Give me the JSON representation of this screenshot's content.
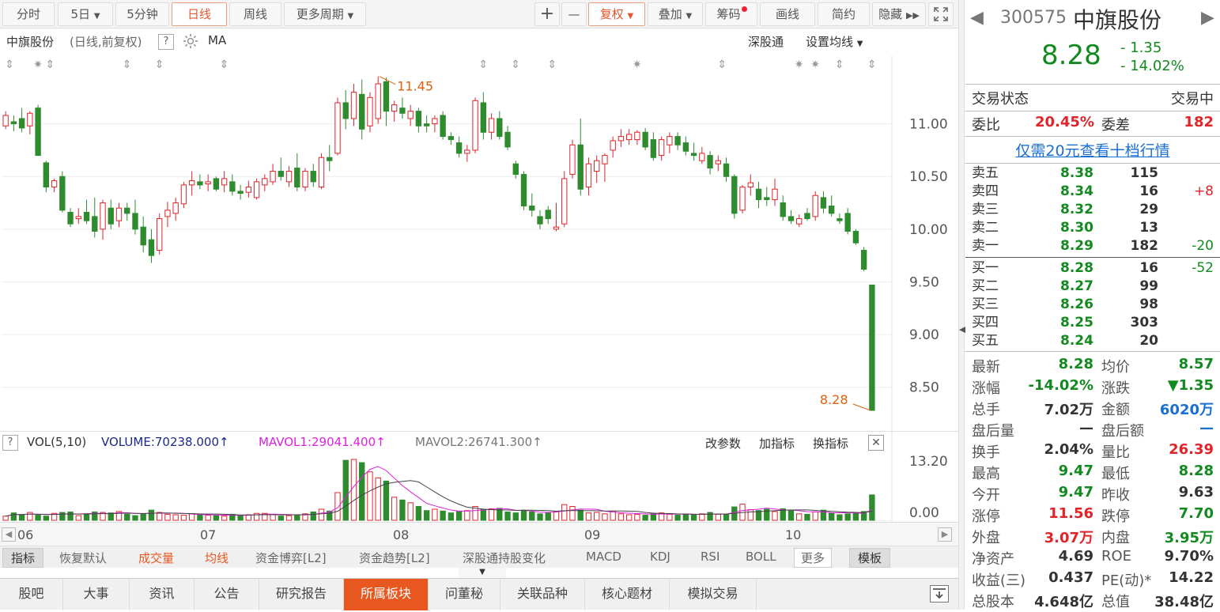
{
  "toolbar": {
    "buttons": [
      "分时",
      "5日",
      "5分钟",
      "日线",
      "周线",
      "更多周期"
    ],
    "active": "日线",
    "plus": "+",
    "minus": "—",
    "fuquan": "复权",
    "diejia": "叠加",
    "chouma": "筹码",
    "huaxian": "画线",
    "jianyue": "简约",
    "yincang": "隐藏"
  },
  "chart_header": {
    "name": "中旗股份",
    "mode": "(日线,前复权)",
    "help": "?",
    "ma": "MA",
    "sgt": "深股通",
    "set_ma": "设置均线"
  },
  "chart_data": [
    {
      "type": "candlestick",
      "x_labels": [
        "06",
        "07",
        "08",
        "09",
        "10"
      ],
      "y_ticks": [
        "11.00",
        "10.50",
        "10.00",
        "9.50",
        "9.00",
        "8.50"
      ],
      "ylim": [
        8.1,
        11.65
      ],
      "annotations": {
        "high": "11.45",
        "last": "8.28"
      },
      "ohlc": [
        [
          10.98,
          11.12,
          10.95,
          11.08
        ],
        [
          11.02,
          11.08,
          10.93,
          11.0
        ],
        [
          11.05,
          11.15,
          10.92,
          10.96
        ],
        [
          10.98,
          11.12,
          10.9,
          11.1
        ],
        [
          11.15,
          11.18,
          10.7,
          10.7
        ],
        [
          10.63,
          10.65,
          10.35,
          10.4
        ],
        [
          10.4,
          10.48,
          10.35,
          10.46
        ],
        [
          10.5,
          10.55,
          10.16,
          10.18
        ],
        [
          10.16,
          10.2,
          10.02,
          10.05
        ],
        [
          10.1,
          10.2,
          10.05,
          10.12
        ],
        [
          10.16,
          10.28,
          10.05,
          10.08
        ],
        [
          10.12,
          10.3,
          9.92,
          9.98
        ],
        [
          10.0,
          10.28,
          9.9,
          10.25
        ],
        [
          10.2,
          10.28,
          10.0,
          10.05
        ],
        [
          10.08,
          10.25,
          10.02,
          10.2
        ],
        [
          10.2,
          10.25,
          10.08,
          10.15
        ],
        [
          10.15,
          10.28,
          9.95,
          10.0
        ],
        [
          10.02,
          10.12,
          9.78,
          9.85
        ],
        [
          9.9,
          10.0,
          9.68,
          9.75
        ],
        [
          9.8,
          10.15,
          9.76,
          10.1
        ],
        [
          10.12,
          10.26,
          10.02,
          10.18
        ],
        [
          10.15,
          10.3,
          10.08,
          10.25
        ],
        [
          10.24,
          10.45,
          10.2,
          10.42
        ],
        [
          10.42,
          10.55,
          10.32,
          10.46
        ],
        [
          10.45,
          10.52,
          10.38,
          10.42
        ],
        [
          10.43,
          10.52,
          10.36,
          10.45
        ],
        [
          10.48,
          10.5,
          10.36,
          10.38
        ],
        [
          10.42,
          10.55,
          10.35,
          10.48
        ],
        [
          10.45,
          10.52,
          10.32,
          10.36
        ],
        [
          10.36,
          10.42,
          10.28,
          10.34
        ],
        [
          10.35,
          10.46,
          10.3,
          10.4
        ],
        [
          10.3,
          10.48,
          10.28,
          10.45
        ],
        [
          10.42,
          10.52,
          10.36,
          10.48
        ],
        [
          10.45,
          10.62,
          10.42,
          10.55
        ],
        [
          10.55,
          10.68,
          10.46,
          10.5
        ],
        [
          10.45,
          10.6,
          10.4,
          10.55
        ],
        [
          10.58,
          10.72,
          10.36,
          10.4
        ],
        [
          10.4,
          10.58,
          10.36,
          10.55
        ],
        [
          10.55,
          10.62,
          10.4,
          10.45
        ],
        [
          10.4,
          10.72,
          10.38,
          10.68
        ],
        [
          10.68,
          10.8,
          10.55,
          10.65
        ],
        [
          10.72,
          11.25,
          10.7,
          11.2
        ],
        [
          11.2,
          11.32,
          10.95,
          11.05
        ],
        [
          11.05,
          11.38,
          10.98,
          11.3
        ],
        [
          11.28,
          11.42,
          10.85,
          10.95
        ],
        [
          10.98,
          11.3,
          10.92,
          11.25
        ],
        [
          11.05,
          11.45,
          11.0,
          11.38
        ],
        [
          11.4,
          11.44,
          10.98,
          11.12
        ],
        [
          11.12,
          11.22,
          11.02,
          11.18
        ],
        [
          11.15,
          11.25,
          11.05,
          11.1
        ],
        [
          11.05,
          11.18,
          10.98,
          11.12
        ],
        [
          11.12,
          11.15,
          10.92,
          10.98
        ],
        [
          11.0,
          11.08,
          10.92,
          10.98
        ],
        [
          11.0,
          11.08,
          10.92,
          11.05
        ],
        [
          11.08,
          11.12,
          10.85,
          10.88
        ],
        [
          10.88,
          10.92,
          10.8,
          10.85
        ],
        [
          10.82,
          10.88,
          10.68,
          10.72
        ],
        [
          10.72,
          10.8,
          10.64,
          10.75
        ],
        [
          10.75,
          11.25,
          10.72,
          11.22
        ],
        [
          11.2,
          11.3,
          10.85,
          10.92
        ],
        [
          10.92,
          11.1,
          10.85,
          11.05
        ],
        [
          11.05,
          11.12,
          10.85,
          10.88
        ],
        [
          10.92,
          10.98,
          10.75,
          10.78
        ],
        [
          10.62,
          10.65,
          10.48,
          10.52
        ],
        [
          10.52,
          10.55,
          10.18,
          10.22
        ],
        [
          10.22,
          10.34,
          10.12,
          10.18
        ],
        [
          10.12,
          10.18,
          10.0,
          10.05
        ],
        [
          10.18,
          10.22,
          10.05,
          10.1
        ],
        [
          10.0,
          10.25,
          9.98,
          10.02
        ],
        [
          10.05,
          10.55,
          10.02,
          10.48
        ],
        [
          10.52,
          10.85,
          10.48,
          10.8
        ],
        [
          10.8,
          11.05,
          10.32,
          10.38
        ],
        [
          10.4,
          10.68,
          10.32,
          10.62
        ],
        [
          10.55,
          10.7,
          10.44,
          10.65
        ],
        [
          10.62,
          10.72,
          10.45,
          10.7
        ],
        [
          10.75,
          10.88,
          10.68,
          10.84
        ],
        [
          10.84,
          10.95,
          10.78,
          10.88
        ],
        [
          10.85,
          10.95,
          10.8,
          10.9
        ],
        [
          10.85,
          10.94,
          10.8,
          10.92
        ],
        [
          10.92,
          10.96,
          10.75,
          10.78
        ],
        [
          10.85,
          10.92,
          10.65,
          10.68
        ],
        [
          10.7,
          10.88,
          10.65,
          10.85
        ],
        [
          10.8,
          10.92,
          10.72,
          10.88
        ],
        [
          10.88,
          10.92,
          10.75,
          10.8
        ],
        [
          10.82,
          10.88,
          10.7,
          10.74
        ],
        [
          10.72,
          10.82,
          10.65,
          10.7
        ],
        [
          10.65,
          10.78,
          10.62,
          10.72
        ],
        [
          10.7,
          10.74,
          10.52,
          10.58
        ],
        [
          10.62,
          10.7,
          10.55,
          10.65
        ],
        [
          10.62,
          10.68,
          10.45,
          10.5
        ],
        [
          10.5,
          10.52,
          10.1,
          10.15
        ],
        [
          10.18,
          10.42,
          10.15,
          10.4
        ],
        [
          10.4,
          10.52,
          10.32,
          10.44
        ],
        [
          10.38,
          10.45,
          10.2,
          10.28
        ],
        [
          10.3,
          10.4,
          10.22,
          10.28
        ],
        [
          10.28,
          10.48,
          10.22,
          10.38
        ],
        [
          10.25,
          10.32,
          10.08,
          10.12
        ],
        [
          10.12,
          10.18,
          10.05,
          10.08
        ],
        [
          10.05,
          10.14,
          10.02,
          10.1
        ],
        [
          10.15,
          10.2,
          10.08,
          10.1
        ],
        [
          10.12,
          10.36,
          10.08,
          10.32
        ],
        [
          10.3,
          10.36,
          10.15,
          10.2
        ],
        [
          10.22,
          10.32,
          10.12,
          10.15
        ],
        [
          10.1,
          10.15,
          10.05,
          10.08
        ],
        [
          10.15,
          10.2,
          9.95,
          9.98
        ],
        [
          9.98,
          10.0,
          9.85,
          9.87
        ],
        [
          9.8,
          9.83,
          9.6,
          9.62
        ],
        [
          9.47,
          9.47,
          8.28,
          8.28
        ]
      ]
    },
    {
      "type": "bar",
      "title": "VOL(5,10)",
      "series": [
        {
          "name": "VOLUME",
          "value": "70238.000"
        },
        {
          "name": "MAVOL1",
          "value": "29041.400"
        },
        {
          "name": "MAVOL2",
          "value": "26741.300"
        }
      ],
      "y_ticks": [
        "13.20",
        "0.00"
      ],
      "ylim": [
        0,
        13.2
      ],
      "volumes": [
        0.9,
        1.6,
        1.2,
        1.7,
        1.1,
        0.9,
        1.5,
        1.7,
        1.8,
        1.0,
        1.2,
        1.8,
        1.7,
        1.6,
        1.9,
        1.3,
        1.0,
        1.4,
        2.2,
        1.7,
        1.3,
        1.2,
        1.1,
        1.4,
        1.2,
        1.1,
        1.0,
        0.9,
        1.3,
        1.1,
        1.2,
        1.5,
        1.5,
        1.3,
        0.9,
        1.0,
        1.2,
        1.4,
        1.8,
        2.4,
        2.0,
        6.0,
        13.0,
        13.2,
        12.5,
        10.5,
        9.2,
        8.5,
        5.0,
        4.4,
        3.8,
        3.0,
        2.1,
        2.4,
        2.0,
        1.6,
        1.9,
        2.1,
        3.0,
        2.4,
        2.5,
        2.6,
        1.8,
        1.6,
        2.2,
        1.8,
        1.4,
        1.6,
        1.9,
        3.4,
        3.0,
        2.2,
        1.6,
        1.7,
        1.4,
        2.0,
        1.4,
        1.2,
        1.3,
        1.1,
        1.5,
        1.6,
        1.3,
        1.1,
        1.3,
        1.2,
        1.4,
        1.7,
        1.3,
        1.2,
        2.9,
        3.5,
        2.3,
        2.1,
        2.4,
        1.9,
        2.5,
        2.2,
        1.4,
        1.3,
        1.8,
        2.2,
        1.6,
        1.2,
        1.4,
        1.5,
        1.9,
        5.5
      ]
    }
  ],
  "vol_header": {
    "help": "?",
    "title": "VOL(5,10)",
    "volume": "VOLUME:70238.000",
    "mavol1": "MAVOL1:29041.400",
    "mavol2": "MAVOL2:26741.300",
    "gai": "改参数",
    "jia": "加指标",
    "huan": "换指标"
  },
  "indicator_bar": {
    "items": [
      "指标",
      "恢复默认",
      "成交量",
      "均线",
      "资金博弈[L2]",
      "资金趋势[L2]",
      "深股通持股变化",
      "MACD",
      "KDJ",
      "RSI",
      "BOLL",
      "更多",
      "模板"
    ]
  },
  "bottom_tabs": [
    "股吧",
    "大事",
    "资讯",
    "公告",
    "研究报告",
    "所属板块",
    "问董秘",
    "关联品种",
    "核心题材",
    "模拟交易"
  ],
  "bottom_active": "所属板块",
  "quote": {
    "code": "300575",
    "name": "中旗股份",
    "price": "8.28",
    "change": "- 1.35",
    "change_pct": "- 14.02%",
    "status_label": "交易状态",
    "status_value": "交易中",
    "weibi_label": "委比",
    "weibi_value": "20.45%",
    "weicha_label": "委差",
    "weicha_value": "182",
    "link": "仅需20元查看十档行情",
    "sell": [
      {
        "label": "卖五",
        "price": "8.38",
        "vol": "115",
        "delta": ""
      },
      {
        "label": "卖四",
        "price": "8.34",
        "vol": "16",
        "delta": "+8"
      },
      {
        "label": "卖三",
        "price": "8.32",
        "vol": "29",
        "delta": ""
      },
      {
        "label": "卖二",
        "price": "8.30",
        "vol": "13",
        "delta": ""
      },
      {
        "label": "卖一",
        "price": "8.29",
        "vol": "182",
        "delta": "-20"
      }
    ],
    "buy": [
      {
        "label": "买一",
        "price": "8.28",
        "vol": "16",
        "delta": "-52"
      },
      {
        "label": "买二",
        "price": "8.27",
        "vol": "99",
        "delta": ""
      },
      {
        "label": "买三",
        "price": "8.26",
        "vol": "98",
        "delta": ""
      },
      {
        "label": "买四",
        "price": "8.25",
        "vol": "303",
        "delta": ""
      },
      {
        "label": "买五",
        "price": "8.24",
        "vol": "20",
        "delta": ""
      }
    ],
    "stats": [
      {
        "l1": "最新",
        "v1": "8.28",
        "c1": "g",
        "l2": "均价",
        "v2": "8.57",
        "c2": "g"
      },
      {
        "l1": "涨幅",
        "v1": "-14.02%",
        "c1": "g",
        "l2": "涨跌",
        "v2": "▼1.35",
        "c2": "g"
      },
      {
        "l1": "总手",
        "v1": "7.02万",
        "c1": "",
        "l2": "金额",
        "v2": "6020万",
        "c2": "b"
      },
      {
        "l1": "盘后量",
        "v1": "—",
        "c1": "",
        "l2": "盘后额",
        "v2": "—",
        "c2": "b"
      },
      {
        "l1": "换手",
        "v1": "2.04%",
        "c1": "",
        "l2": "量比",
        "v2": "26.39",
        "c2": "r"
      },
      {
        "l1": "最高",
        "v1": "9.47",
        "c1": "g",
        "l2": "最低",
        "v2": "8.28",
        "c2": "g"
      },
      {
        "l1": "今开",
        "v1": "9.47",
        "c1": "g",
        "l2": "昨收",
        "v2": "9.63",
        "c2": ""
      },
      {
        "l1": "涨停",
        "v1": "11.56",
        "c1": "r",
        "l2": "跌停",
        "v2": "7.70",
        "c2": "g"
      },
      {
        "l1": "外盘",
        "v1": "3.07万",
        "c1": "r",
        "l2": "内盘",
        "v2": "3.95万",
        "c2": "g"
      },
      {
        "l1": "净资产",
        "v1": "4.69",
        "c1": "",
        "l2": "ROE",
        "v2": "9.70%",
        "c2": ""
      },
      {
        "l1": "收益(三)",
        "v1": "0.437",
        "c1": "",
        "l2": "PE(动)*",
        "v2": "14.22",
        "c2": ""
      },
      {
        "l1": "总股本",
        "v1": "4.648亿",
        "c1": "",
        "l2": "总值",
        "v2": "38.48亿",
        "c2": ""
      }
    ]
  },
  "colors": {
    "up": "#e1242a",
    "down": "#2e8b2e",
    "accent": "#e8571f",
    "ma1": "#e020e0",
    "ma2": "#444444"
  }
}
